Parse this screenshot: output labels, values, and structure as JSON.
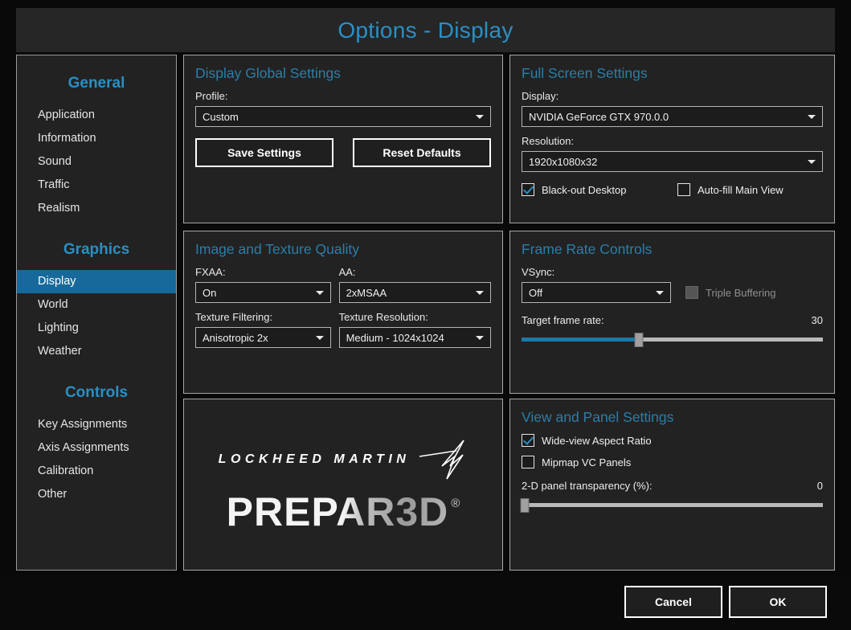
{
  "window": {
    "title": "Options - Display"
  },
  "accent": {
    "blue": "#2a8fc4",
    "panel_title": "#2b7ea8",
    "selected": "#17699b",
    "slider_fill": "#1a7aa8"
  },
  "sidebar": {
    "sections": [
      {
        "heading": "General",
        "items": [
          "Application",
          "Information",
          "Sound",
          "Traffic",
          "Realism"
        ]
      },
      {
        "heading": "Graphics",
        "items": [
          "Display",
          "World",
          "Lighting",
          "Weather"
        ]
      },
      {
        "heading": "Controls",
        "items": [
          "Key Assignments",
          "Axis Assignments",
          "Calibration",
          "Other"
        ]
      }
    ],
    "selected": "Display"
  },
  "display_global": {
    "title": "Display Global Settings",
    "profile_label": "Profile:",
    "profile_value": "Custom",
    "save_label": "Save Settings",
    "reset_label": "Reset Defaults"
  },
  "full_screen": {
    "title": "Full Screen Settings",
    "display_label": "Display:",
    "display_value": "NVIDIA GeForce GTX 970.0.0",
    "resolution_label": "Resolution:",
    "resolution_value": "1920x1080x32",
    "blackout_label": "Black-out Desktop",
    "blackout_checked": true,
    "autofill_label": "Auto-fill Main View",
    "autofill_checked": false
  },
  "image_texture": {
    "title": "Image and Texture Quality",
    "fxaa_label": "FXAA:",
    "fxaa_value": "On",
    "aa_label": "AA:",
    "aa_value": "2xMSAA",
    "filtering_label": "Texture Filtering:",
    "filtering_value": "Anisotropic 2x",
    "resolution_label": "Texture Resolution:",
    "resolution_value": "Medium - 1024x1024"
  },
  "frame_rate": {
    "title": "Frame Rate Controls",
    "vsync_label": "VSync:",
    "vsync_value": "Off",
    "triple_label": "Triple Buffering",
    "triple_checked": false,
    "target_label": "Target frame rate:",
    "target_value": "30",
    "target_percent": 39
  },
  "view_panel": {
    "title": "View and Panel Settings",
    "wideview_label": "Wide-view Aspect Ratio",
    "wideview_checked": true,
    "mipmap_label": "Mipmap VC Panels",
    "mipmap_checked": false,
    "transparency_label": "2-D panel transparency (%):",
    "transparency_value": "0",
    "transparency_percent": 0
  },
  "logo": {
    "company": "LOCKHEED MARTIN",
    "product": "PREPAR3D",
    "trademark": "®"
  },
  "footer": {
    "cancel_label": "Cancel",
    "ok_label": "OK"
  }
}
